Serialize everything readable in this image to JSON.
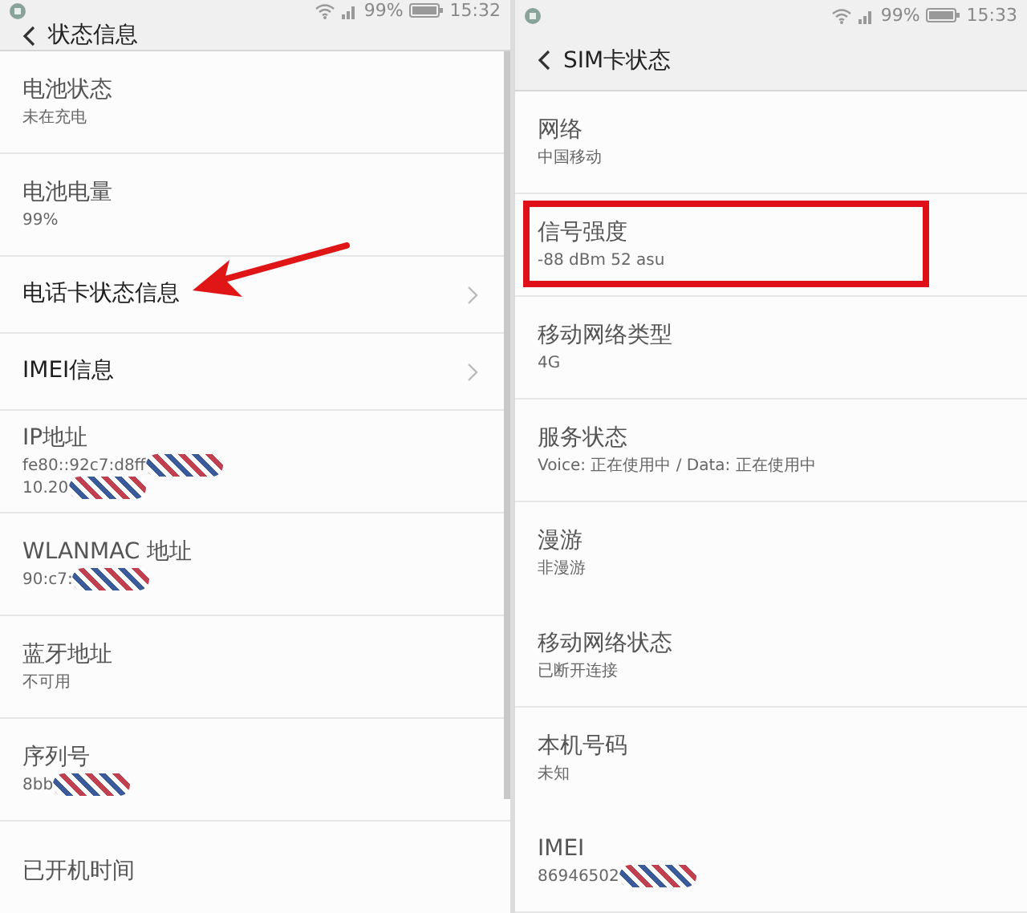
{
  "panes": [
    {
      "status_bar": {
        "battery": "99%",
        "time": "15:32"
      },
      "title": "状态信息",
      "scrollable": true,
      "items": [
        {
          "kind": "info",
          "title": "电池状态",
          "lines": [
            {
              "text": "未在充电",
              "redacted": false
            }
          ]
        },
        {
          "kind": "info",
          "title": "电池电量",
          "lines": [
            {
              "text": "99%",
              "redacted": false
            }
          ]
        },
        {
          "kind": "link",
          "title": "电话卡状态信息",
          "pointed_at": true
        },
        {
          "kind": "link",
          "title": "IMEI信息"
        },
        {
          "kind": "info",
          "title": "IP地址",
          "lines": [
            {
              "text": "fe80::92c7:d8ff",
              "redacted": true
            },
            {
              "text": "10.20",
              "redacted": true
            }
          ]
        },
        {
          "kind": "info",
          "title": "WLANMAC 地址",
          "lines": [
            {
              "text": "90:c7:",
              "redacted": true
            }
          ]
        },
        {
          "kind": "info",
          "title": "蓝牙地址",
          "lines": [
            {
              "text": "不可用",
              "redacted": false
            }
          ]
        },
        {
          "kind": "info",
          "title": "序列号",
          "lines": [
            {
              "text": "8bb",
              "redacted": true
            }
          ]
        },
        {
          "kind": "info",
          "title": "已开机时间"
        }
      ]
    },
    {
      "status_bar": {
        "battery": "99%",
        "time": "15:33"
      },
      "title": "SIM卡状态",
      "scrollable": false,
      "items": [
        {
          "kind": "info",
          "title": "网络",
          "lines": [
            {
              "text": "中国移动",
              "redacted": false
            }
          ]
        },
        {
          "kind": "info",
          "title": "信号强度",
          "lines": [
            {
              "text": "-88 dBm 52 asu",
              "redacted": false
            }
          ],
          "boxed": true
        },
        {
          "kind": "info",
          "title": "移动网络类型",
          "lines": [
            {
              "text": "4G",
              "redacted": false
            }
          ]
        },
        {
          "kind": "info",
          "title": "服务状态",
          "lines": [
            {
              "text": "Voice: 正在使用中 / Data: 正在使用中",
              "redacted": false
            }
          ]
        },
        {
          "kind": "info",
          "title": "漫游",
          "lines": [
            {
              "text": "非漫游",
              "redacted": false
            }
          ],
          "divider": false
        },
        {
          "kind": "info",
          "title": "移动网络状态",
          "lines": [
            {
              "text": "已断开连接",
              "redacted": false
            }
          ]
        },
        {
          "kind": "info",
          "title": "本机号码",
          "lines": [
            {
              "text": "未知",
              "redacted": false
            }
          ],
          "divider": false
        },
        {
          "kind": "info",
          "title": "IMEI",
          "lines": [
            {
              "text": "86946502",
              "redacted": true
            }
          ]
        }
      ]
    }
  ]
}
